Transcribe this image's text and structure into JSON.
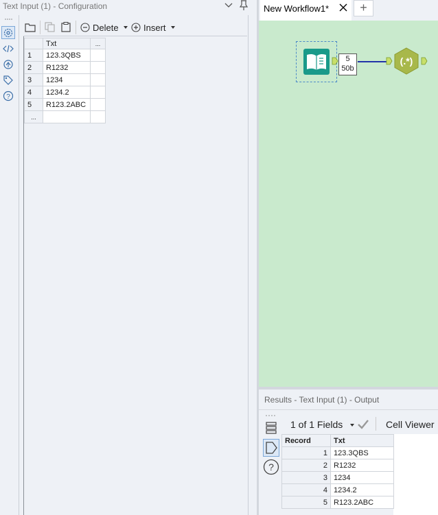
{
  "config_panel": {
    "title": "Text Input (1) - Configuration",
    "toolbar": {
      "delete_label": "Delete",
      "insert_label": "Insert"
    },
    "table": {
      "header": "Txt",
      "ellipsis": "...",
      "rows": [
        {
          "num": "1",
          "txt": "123.3QBS"
        },
        {
          "num": "2",
          "txt": "R1232"
        },
        {
          "num": "3",
          "txt": "1234"
        },
        {
          "num": "4",
          "txt": "1234.2"
        },
        {
          "num": "5",
          "txt": "R123.2ABC"
        }
      ],
      "new_row": "..."
    }
  },
  "workflow": {
    "tab_label": "New Workflow1*",
    "tab_add": "+",
    "connection": {
      "records": "5",
      "size": "50b"
    },
    "regex_label": "(.*)"
  },
  "results": {
    "title": "Results - Text Input (1) - Output",
    "fields_label": "1 of 1 Fields",
    "viewer_label": "Cell Viewer",
    "columns": {
      "record": "Record",
      "txt": "Txt"
    },
    "rows": [
      {
        "record": "1",
        "txt": "123.3QBS"
      },
      {
        "record": "2",
        "txt": "R1232"
      },
      {
        "record": "3",
        "txt": "1234"
      },
      {
        "record": "4",
        "txt": "1234.2"
      },
      {
        "record": "5",
        "txt": "R123.2ABC"
      }
    ]
  },
  "colors": {
    "canvas": "#c9eacd",
    "text_input_tool": "#1a9a8a",
    "regex_tool": "#a8b84a",
    "connection": "#2232a8",
    "selection": "#4a88c8"
  }
}
